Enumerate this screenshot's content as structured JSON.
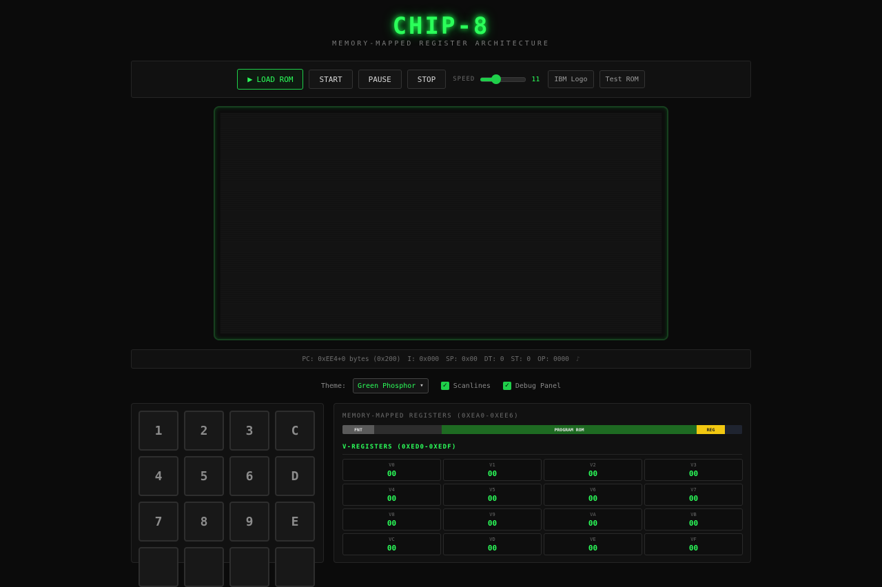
{
  "header": {
    "title": "CHIP-8",
    "subtitle": "MEMORY-MAPPED REGISTER ARCHITECTURE"
  },
  "toolbar": {
    "load_icon": "▶",
    "load_label": "LOAD ROM",
    "start_label": "START",
    "pause_label": "PAUSE",
    "stop_label": "STOP",
    "speed_label": "SPEED",
    "speed_value": "11",
    "speed_fraction": 0.35,
    "rom_buttons": [
      "IBM Logo",
      "Test ROM"
    ]
  },
  "status": {
    "pc": "PC: 0xEE4+0 bytes (0x200)",
    "i": "I: 0x000",
    "sp": "SP: 0x00",
    "dt": "DT: 0",
    "st": "ST: 0",
    "op": "OP: 0000",
    "sound_icon": "♪"
  },
  "settings": {
    "theme_label": "Theme:",
    "theme_value": "Green Phosphor",
    "scanlines_label": "Scanlines",
    "scanlines_checked": true,
    "debug_label": "Debug Panel",
    "debug_checked": true
  },
  "keypad": {
    "keys": [
      "1",
      "2",
      "3",
      "C",
      "4",
      "5",
      "6",
      "D",
      "7",
      "8",
      "9",
      "E"
    ]
  },
  "debug": {
    "title": "MEMORY-MAPPED REGISTERS (0XEA0-0XEE6)",
    "memory_map": [
      {
        "label": "FNT",
        "color": "#5a5a5a"
      },
      {
        "label": "",
        "color": "#2d2d2d"
      },
      {
        "label": "PROGRAM ROM",
        "color": "#1e6b22"
      },
      {
        "label": "REG",
        "color": "#f2c811"
      },
      {
        "label": "",
        "color": "#1f2430"
      }
    ],
    "vreg_title": "V-REGISTERS (0XED0-0XEDF)",
    "registers": [
      {
        "name": "V0",
        "value": "00"
      },
      {
        "name": "V1",
        "value": "00"
      },
      {
        "name": "V2",
        "value": "00"
      },
      {
        "name": "V3",
        "value": "00"
      },
      {
        "name": "V4",
        "value": "00"
      },
      {
        "name": "V5",
        "value": "00"
      },
      {
        "name": "V6",
        "value": "00"
      },
      {
        "name": "V7",
        "value": "00"
      },
      {
        "name": "V8",
        "value": "00"
      },
      {
        "name": "V9",
        "value": "00"
      },
      {
        "name": "VA",
        "value": "00"
      },
      {
        "name": "VB",
        "value": "00"
      },
      {
        "name": "VC",
        "value": "00"
      },
      {
        "name": "VD",
        "value": "00"
      },
      {
        "name": "VE",
        "value": "00"
      },
      {
        "name": "VF",
        "value": "00"
      }
    ]
  },
  "colors": {
    "accent": "#2bff5a",
    "background": "#0b0b0b"
  }
}
